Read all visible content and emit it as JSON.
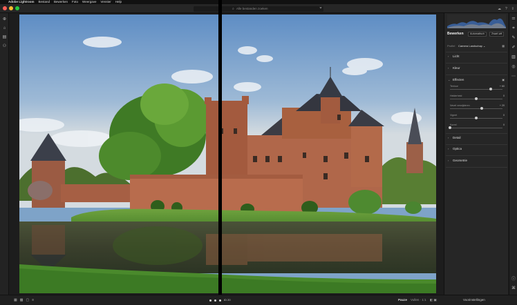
{
  "menubar": {
    "apple": "",
    "items": [
      "Adobe Lightroom",
      "Bestand",
      "Bewerken",
      "Foto",
      "Weergave",
      "Venster",
      "Help"
    ]
  },
  "search": {
    "placeholder": "Alle bestanden zoeken"
  },
  "right_panel": {
    "title": "Bewerken",
    "auto_label": "Automatisch",
    "bw_label": "Zwart-wit",
    "profile_label": "Profiel",
    "profile_value": "Camera Landschap",
    "sections": [
      {
        "label": "Licht",
        "expanded": false
      },
      {
        "label": "Kleur",
        "expanded": false
      },
      {
        "label": "Effecten",
        "expanded": true
      },
      {
        "label": "Detail",
        "expanded": false
      },
      {
        "label": "Optica",
        "expanded": false
      },
      {
        "label": "Geometrie",
        "expanded": false
      }
    ],
    "effects_sliders": [
      {
        "label": "Textuur",
        "value": "+ 60",
        "position": 0.77
      },
      {
        "label": "Helderheid",
        "value": "0",
        "position": 0.5
      },
      {
        "label": "Nevel verwijderen",
        "value": "+ 20",
        "position": 0.6
      },
      {
        "label": "Vignet",
        "value": "0",
        "position": 0.5
      },
      {
        "label": "Korrel",
        "value": "0",
        "position": 0.0
      }
    ]
  },
  "bottombar": {
    "zoom_label": "Aanpassen",
    "zoom_value": "Vullen · 1:1",
    "pause_label": "Pauze",
    "prefs_label": "Voorinstellingen",
    "center_label": "ID 20"
  },
  "colors": {
    "traffic_red": "#fe5f57",
    "traffic_yellow": "#febc2e",
    "traffic_green": "#28c840",
    "histogram_blue": "#3d6cb3",
    "histogram_gray": "#8c8c8c"
  }
}
